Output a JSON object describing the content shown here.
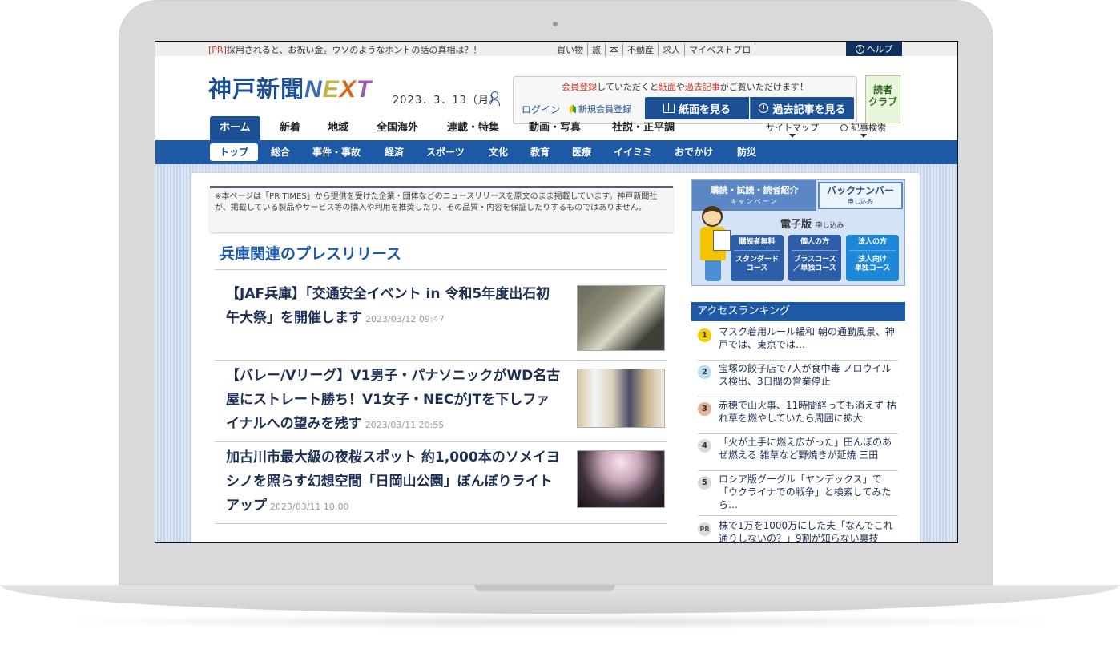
{
  "topbar": {
    "pr_tag": "[PR]",
    "pr_text": "採用されると、お祝い金。ウソのようなホントの話の真相は？！",
    "links": [
      "買い物",
      "旅",
      "本",
      "不動産",
      "求人",
      "マイベストプロ"
    ],
    "help": "ヘルプ"
  },
  "header": {
    "logo_kanji": "神戸新聞",
    "logo_n": "N",
    "logo_e": "E",
    "logo_x": "X",
    "logo_t": "T",
    "date": "2023．3．13（月）",
    "member_msg_1": "会員登録",
    "member_msg_2": "していただくと",
    "member_msg_3": "紙面",
    "member_msg_4": "や",
    "member_msg_5": "過去記事",
    "member_msg_6": "がご覧いただけます！",
    "login": "ログイン",
    "register": "新規会員登録",
    "paper_btn": "紙面を見る",
    "past_btn": "過去記事を見る",
    "reader_club_1": "読者",
    "reader_club_2": "クラブ"
  },
  "mainnav": {
    "items": [
      "ホーム",
      "新着",
      "地域",
      "全国海外",
      "連載・特集",
      "動画・写真",
      "社説・正平調"
    ],
    "sitemap": "サイトマップ",
    "search": "記事検索"
  },
  "subnav": {
    "items": [
      "トップ",
      "総合",
      "事件・事故",
      "経済",
      "スポーツ",
      "文化",
      "教育",
      "医療",
      "イイミミ",
      "おでかけ",
      "防災"
    ]
  },
  "notice": "※本ページは「PR TIMES」から提供を受けた企業・団体などのニュースリリースを原文のまま掲載しています。神戸新聞社が、掲載している製品やサービス等の購入や利用を推奨したり、その品質・内容を保証したりするものではありません。",
  "section_title": "兵庫関連のプレスリリース",
  "articles": [
    {
      "title": "【JAF兵庫】「交通安全イベント in 令和5年度出石初午大祭」を開催します",
      "date": "2023/03/12 09:47"
    },
    {
      "title": "【バレー/Vリーグ】V1男子・パナソニックがWD名古屋にストレート勝ち！V1女子・NECがJTを下しファイナルへの望みを残す",
      "date": "2023/03/11 20:55"
    },
    {
      "title": "加古川市最大級の夜桜スポット 約1,000本のソメイヨシノを照らす幻想空間「日岡山公園」ぼんぼりライトアップ",
      "date": "2023/03/11 10:00"
    }
  ],
  "promo": {
    "tab1_main": "購読・試読・読者紹介",
    "tab1_sub": "キャンペーン",
    "tab2_main": "バックナンバー",
    "tab2_sub": "申し込み",
    "edition_main": "電子版",
    "edition_sub": "申し込み",
    "buttons": [
      {
        "head": "購読者無料",
        "body_1": "スタンダード",
        "body_2": "コース"
      },
      {
        "head": "個人の方",
        "body_1": "プラスコース",
        "body_2": "／単独コース"
      },
      {
        "head": "法人の方",
        "body_1": "法人向け",
        "body_2": "単独コース"
      }
    ]
  },
  "ranking": {
    "title": "アクセスランキング",
    "items": [
      {
        "num": "1",
        "text": "マスク着用ルール緩和 朝の通勤風景、神戸では、東京では…"
      },
      {
        "num": "2",
        "text": "宝塚の餃子店で7人が食中毒 ノロウイルス検出、3日間の営業停止"
      },
      {
        "num": "3",
        "text": "赤穂で山火事、11時間経っても消えず 枯れ草を燃やしていたら周囲に拡大"
      },
      {
        "num": "4",
        "text": "「火が土手に燃え広がった」田んぼのあぜ燃える 雑草など野焼きが延焼 三田"
      },
      {
        "num": "5",
        "text": "ロシア版グーグル「ヤンデックス」で「ウクライナでの戦争」と検索してみたら…"
      },
      {
        "num": "PR",
        "text": "株で1万を1000万にした夫「なんでこれ通りしないの？」9割が知らない裏技"
      }
    ]
  }
}
